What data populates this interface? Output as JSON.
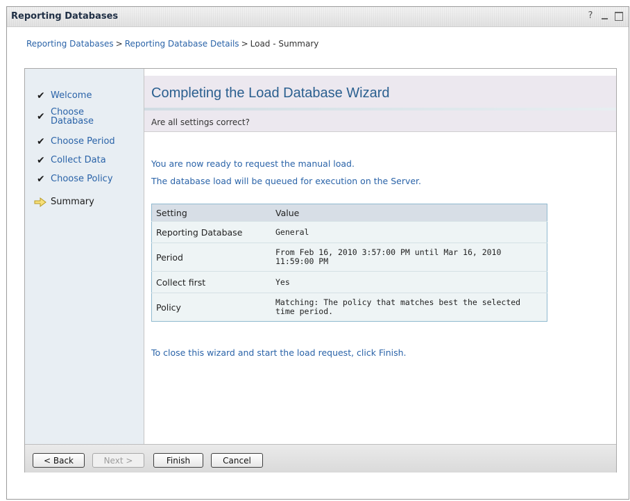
{
  "window": {
    "title": "Reporting Databases",
    "help_label": "?"
  },
  "breadcrumb": {
    "items": [
      "Reporting Databases",
      "Reporting Database Details"
    ],
    "separator": ">",
    "current": "Load - Summary"
  },
  "steps": [
    {
      "label": "Welcome",
      "state": "done"
    },
    {
      "label": "Choose Database",
      "state": "done"
    },
    {
      "label": "Choose Period",
      "state": "done"
    },
    {
      "label": "Collect Data",
      "state": "done"
    },
    {
      "label": "Choose Policy",
      "state": "done"
    },
    {
      "label": "Summary",
      "state": "current"
    }
  ],
  "main": {
    "title": "Completing the Load Database Wizard",
    "question": "Are all settings correct?",
    "ready_message": "You are now ready to request the manual load.",
    "queue_message": "The database load will be queued for execution on the Server.",
    "finish_hint": "To close this wizard and start the load request, click Finish."
  },
  "table": {
    "headers": [
      "Setting",
      "Value"
    ],
    "rows": [
      {
        "setting": "Reporting Database",
        "value": "General"
      },
      {
        "setting": "Period",
        "value": "From Feb 16, 2010 3:57:00 PM until Mar 16, 2010 11:59:00 PM"
      },
      {
        "setting": "Collect first",
        "value": "Yes"
      },
      {
        "setting": "Policy",
        "value": "Matching: The policy that matches best the selected time period."
      }
    ]
  },
  "buttons": {
    "back": "< Back",
    "next": "Next >",
    "finish": "Finish",
    "cancel": "Cancel"
  },
  "colors": {
    "link": "#2a63a8",
    "title": "#2a5f8f",
    "sidebar": "#e8eef3",
    "header_band": "#ece8ef"
  }
}
